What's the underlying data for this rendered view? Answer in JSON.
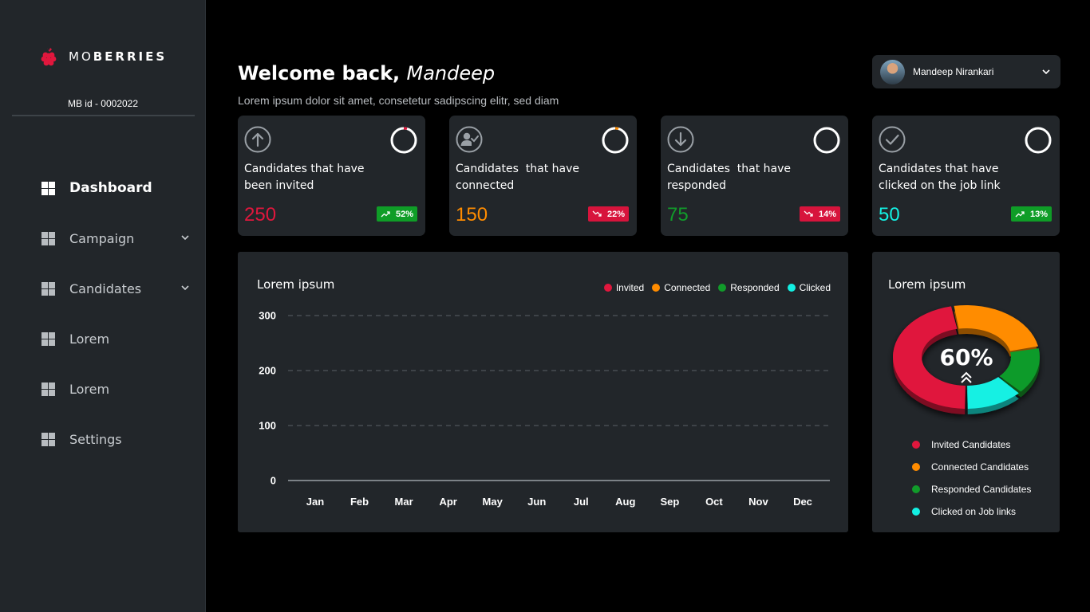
{
  "brand": {
    "name_a": "MO",
    "name_b": "BERRIES"
  },
  "mb_id": "MB id - 0002022",
  "nav": {
    "dashboard": "Dashboard",
    "campaign": "Campaign",
    "candidates": "Candidates",
    "lorem1": "Lorem",
    "lorem2": "Lorem",
    "settings": "Settings"
  },
  "header": {
    "welcome": "Welcome back,",
    "name": "Mandeep",
    "subtitle": "Lorem ipsum dolor sit amet, consetetur sadipscing elitr, sed diam"
  },
  "user": {
    "name": "Mandeep Nirankari"
  },
  "colors": {
    "invited": "#e0173d",
    "connected": "#ff8c00",
    "responded": "#119b2a",
    "clicked": "#13f0e3",
    "up": "#0f9d27",
    "down": "#d7143c"
  },
  "cards": [
    {
      "icon": "arrow-up-circle-icon",
      "title_l1": "Candidates that have",
      "title_l2": "been invited",
      "value": "250",
      "change": "52%",
      "trend": "up"
    },
    {
      "icon": "user-check-icon",
      "title_l1": "Candidates  that have",
      "title_l2": "connected",
      "value": "150",
      "change": "22%",
      "trend": "down"
    },
    {
      "icon": "arrow-down-circle-icon",
      "title_l1": "Candidates  that have",
      "title_l2": "responded",
      "value": "75",
      "change": "14%",
      "trend": "down"
    },
    {
      "icon": "check-circle-icon",
      "title_l1": "Candidates that have",
      "title_l2": "clicked on the job link",
      "value": "50",
      "change": "13%",
      "trend": "up"
    }
  ],
  "line_panel": {
    "title": "Lorem ipsum",
    "legend": [
      "Invited",
      "Connected",
      "Responded",
      "Clicked"
    ]
  },
  "donut_panel": {
    "title": "Lorem ipsum",
    "center_value": "60%",
    "legend": [
      "Invited Candidates",
      "Connected Candidates",
      "Responded Candidates",
      "Clicked on Job links"
    ]
  },
  "chart_data": [
    {
      "type": "line",
      "title": "Lorem ipsum",
      "categories": [
        "Jan",
        "Feb",
        "Mar",
        "Apr",
        "May",
        "Jun",
        "Jul",
        "Aug",
        "Sep",
        "Oct",
        "Nov",
        "Dec"
      ],
      "yticks": [
        "0",
        "100",
        "200",
        "300"
      ],
      "ylim": [
        0,
        300
      ],
      "grid": true,
      "legend_position": "top-right",
      "series": [
        {
          "name": "Invited",
          "values": []
        },
        {
          "name": "Connected",
          "values": []
        },
        {
          "name": "Responded",
          "values": []
        },
        {
          "name": "Clicked",
          "values": []
        }
      ]
    },
    {
      "type": "pie",
      "title": "Lorem ipsum",
      "center_label": "60%",
      "categories": [
        "Invited Candidates",
        "Connected Candidates",
        "Responded Candidates",
        "Clicked on Job links"
      ],
      "values": [
        47,
        25,
        15,
        13
      ]
    }
  ]
}
